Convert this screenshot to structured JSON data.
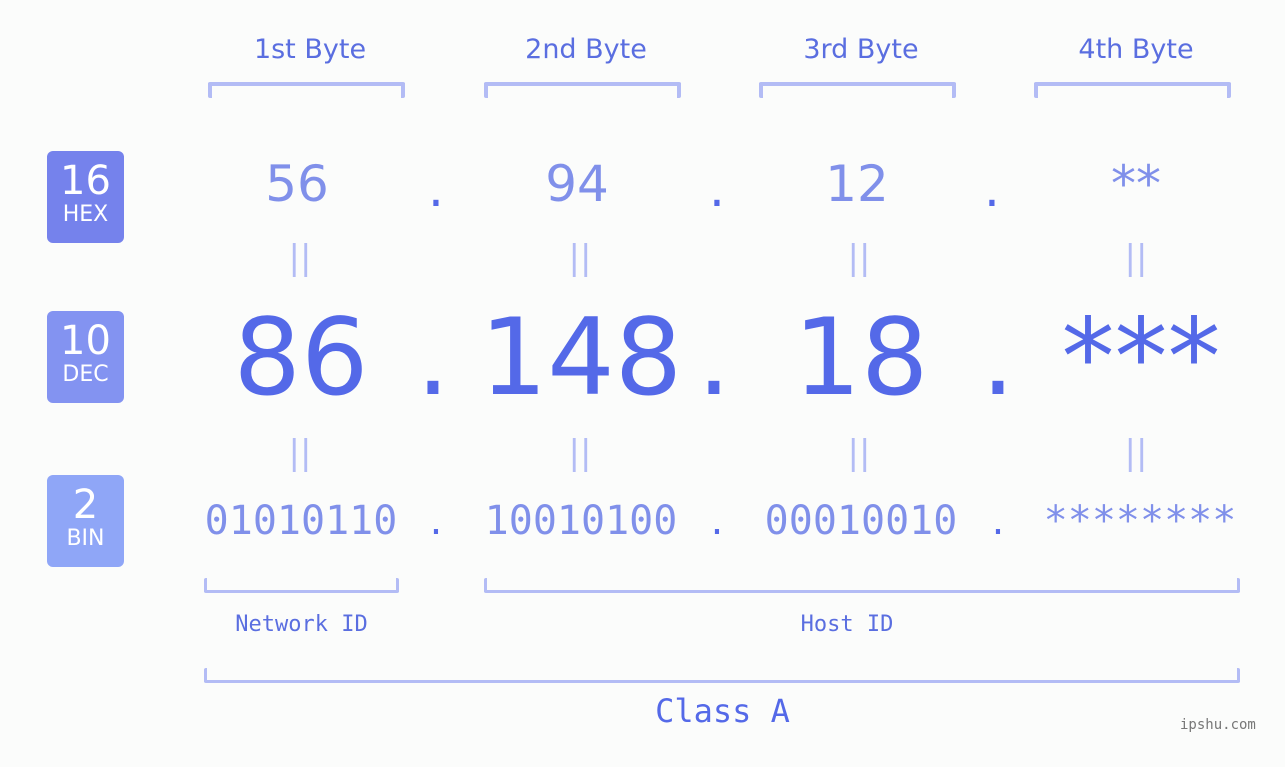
{
  "headers": [
    "1st Byte",
    "2nd Byte",
    "3rd Byte",
    "4th Byte"
  ],
  "badges": [
    {
      "num": "16",
      "label": "HEX",
      "color": "#7582ec"
    },
    {
      "num": "10",
      "label": "DEC",
      "color": "#8393f1"
    },
    {
      "num": "2",
      "label": "BIN",
      "color": "#8fa6f7"
    }
  ],
  "hex": [
    "56",
    "94",
    "12",
    "**"
  ],
  "dec": [
    "86",
    "148",
    "18",
    "***"
  ],
  "bin": [
    "01010110",
    "10010100",
    "00010010",
    "********"
  ],
  "separator": ".",
  "equals": "||",
  "network_id_label": "Network ID",
  "host_id_label": "Host ID",
  "class_label": "Class A",
  "watermark": "ipshu.com"
}
